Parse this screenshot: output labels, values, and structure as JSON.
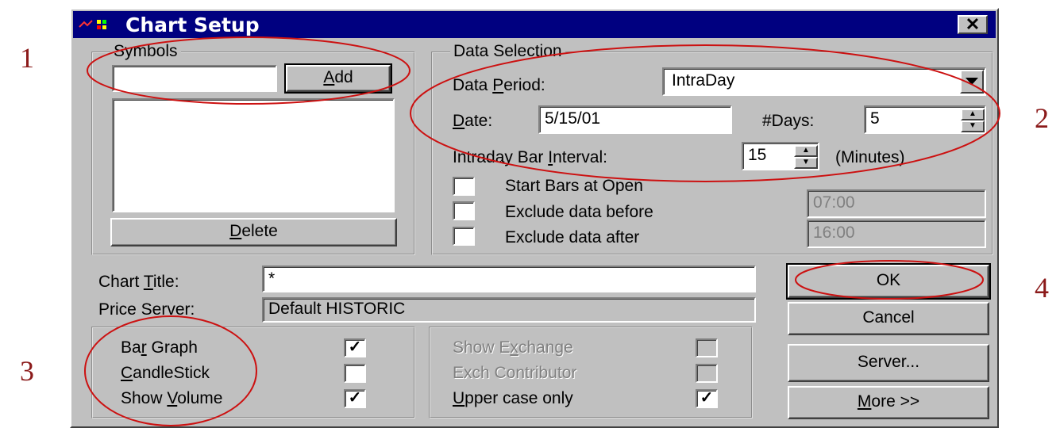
{
  "annotations": [
    "1",
    "2",
    "3",
    "4"
  ],
  "window": {
    "title": "Chart Setup",
    "close_label": "✕"
  },
  "symbols": {
    "legend": "Symbols",
    "input_value": "",
    "add_label": "Add",
    "delete_label": "Delete"
  },
  "data_selection": {
    "legend": "Data Selection",
    "period_label": "Data Period:",
    "period_value": "IntraDay",
    "date_label": "Date:",
    "date_value": "5/15/01",
    "days_label": "#Days:",
    "days_value": "5",
    "interval_label": "Intraday Bar Interval:",
    "interval_value": "15",
    "interval_unit": "(Minutes)",
    "start_bars_label": "Start Bars at Open",
    "exclude_before_label": "Exclude data before",
    "exclude_before_value": "07:00",
    "exclude_after_label": "Exclude data after",
    "exclude_after_value": "16:00"
  },
  "chart_title": {
    "label": "Chart Title:",
    "value": "*"
  },
  "price_server": {
    "label": "Price Server:",
    "value": "Default HISTORIC"
  },
  "graph_options": {
    "bar_graph_label": "Bar Graph",
    "bar_graph_checked": true,
    "candlestick_label": "CandleStick",
    "candlestick_checked": false,
    "show_volume_label": "Show Volume",
    "show_volume_checked": true
  },
  "exchange_options": {
    "show_exchange_label": "Show Exchange",
    "exch_contributor_label": "Exch Contributor",
    "upper_case_label": "Upper case only",
    "upper_case_checked": true
  },
  "buttons": {
    "ok": "OK",
    "cancel": "Cancel",
    "server": "Server...",
    "more": "More >>"
  },
  "colors": {
    "title_bar": "#000080",
    "dialog_face": "#c0c0c0",
    "annotation": "#cc1111"
  }
}
